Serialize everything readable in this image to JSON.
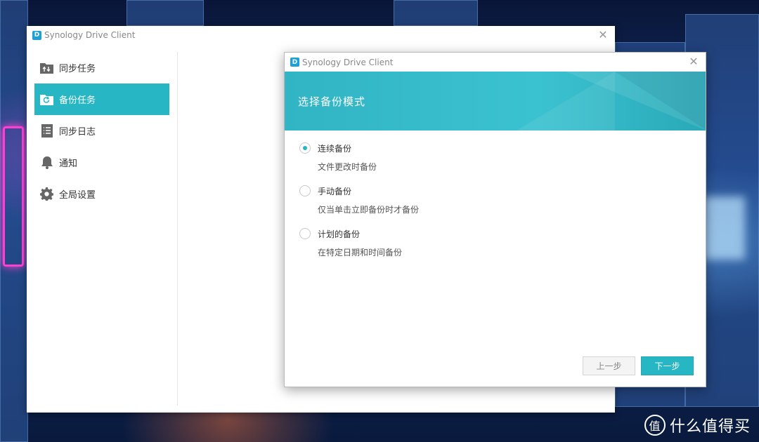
{
  "main_window": {
    "title": "Synology Drive Client",
    "logo_text": "D",
    "close_glyph": "✕",
    "sidebar": {
      "items": [
        {
          "label": "同步任务",
          "icon": "sync-task-icon",
          "active": false
        },
        {
          "label": "备份任务",
          "icon": "backup-task-icon",
          "active": true
        },
        {
          "label": "同步日志",
          "icon": "sync-log-icon",
          "active": false
        },
        {
          "label": "通知",
          "icon": "bell-icon",
          "active": false
        },
        {
          "label": "全局设置",
          "icon": "gear-icon",
          "active": false
        }
      ]
    }
  },
  "dialog": {
    "title": "Synology Drive Client",
    "logo_text": "D",
    "close_glyph": "✕",
    "banner_title": "选择备份模式",
    "options": [
      {
        "label": "连续备份",
        "description": "文件更改时备份",
        "checked": true
      },
      {
        "label": "手动备份",
        "description": "仅当单击立即备份时才备份",
        "checked": false
      },
      {
        "label": "计划的备份",
        "description": "在特定日期和时间备份",
        "checked": false
      }
    ],
    "buttons": {
      "prev": "上一步",
      "next": "下一步"
    }
  },
  "watermark": {
    "icon_glyph": "值",
    "text": "什么值得买"
  },
  "colors": {
    "accent": "#27b6c3",
    "banner": "#31b4c4",
    "text": "#333333"
  }
}
